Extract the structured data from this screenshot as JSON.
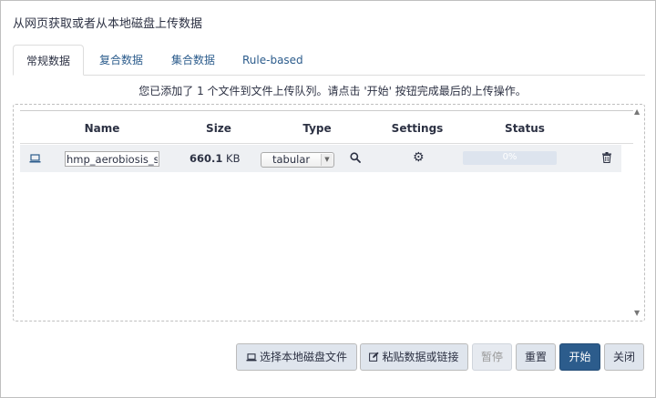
{
  "dialog": {
    "title": "从网页获取或者从本地磁盘上传数据"
  },
  "tabs": [
    {
      "label": "常规数据",
      "active": true
    },
    {
      "label": "复合数据",
      "active": false
    },
    {
      "label": "集合数据",
      "active": false
    },
    {
      "label": "Rule-based",
      "active": false
    }
  ],
  "info_message": "您已添加了 1 个文件到文件上传队列。请点击 '开始' 按钮完成最后的上传操作。",
  "table": {
    "headers": {
      "name": "Name",
      "size": "Size",
      "type": "Type",
      "settings": "Settings",
      "status": "Status"
    },
    "rows": [
      {
        "source_icon": "laptop-icon",
        "name": "hmp_aerobiosis_sm",
        "size_value": "660.1",
        "size_unit": "KB",
        "type": "tabular",
        "status_text": "0%",
        "progress": 0
      }
    ]
  },
  "buttons": {
    "choose_local": "选择本地磁盘文件",
    "paste_fetch": "粘贴数据或链接",
    "pause": "暂停",
    "reset": "重置",
    "start": "开始",
    "close": "关闭"
  },
  "colors": {
    "accent": "#2c5c8c",
    "button_bg": "#dfe5ed",
    "row_bg": "#eef0f3",
    "progress_bg": "#dde4ee"
  }
}
